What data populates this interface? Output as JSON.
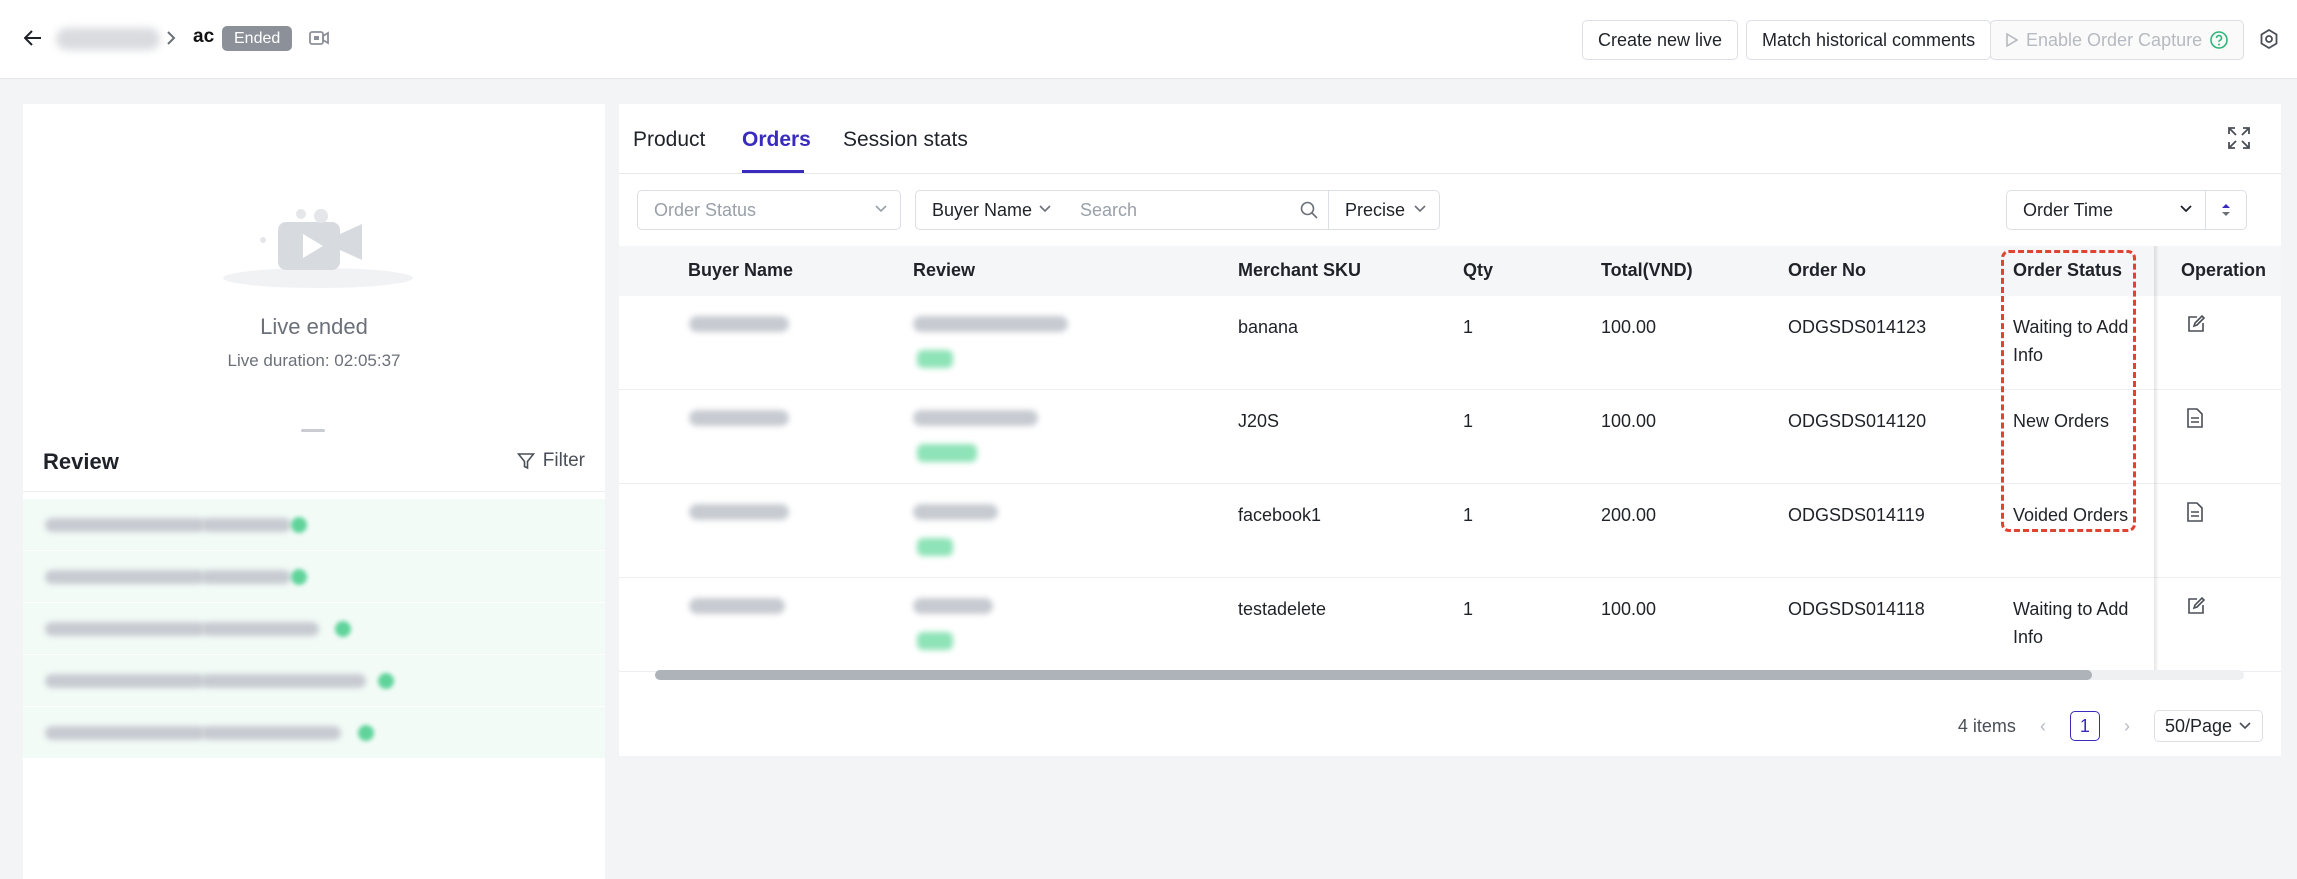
{
  "header": {
    "title": "ac",
    "status_badge": "Ended",
    "buttons": {
      "create_new_live": "Create new live",
      "match_historical_comments": "Match historical comments",
      "enable_order_capture": "Enable Order Capture"
    }
  },
  "live": {
    "status_text": "Live ended",
    "duration_text": "Live duration: 02:05:37"
  },
  "review": {
    "title": "Review",
    "filter_label": "Filter"
  },
  "tabs": [
    {
      "label": "Product"
    },
    {
      "label": "Orders"
    },
    {
      "label": "Session stats"
    }
  ],
  "active_tab": "Orders",
  "filters": {
    "order_status_placeholder": "Order Status",
    "search_field": "Buyer Name",
    "search_placeholder": "Search",
    "match_mode": "Precise",
    "sort_field": "Order Time"
  },
  "table": {
    "columns": [
      "Buyer Name",
      "Review",
      "Merchant SKU",
      "Qty",
      "Total(VND)",
      "Order No",
      "Order Status",
      "Operation"
    ],
    "rows": [
      {
        "merchant_sku": "banana",
        "qty": "1",
        "total": "100.00",
        "order_no": "ODGSDS014123",
        "order_status": "Waiting to Add Info",
        "operation_icon": "edit-icon"
      },
      {
        "merchant_sku": "J20S",
        "qty": "1",
        "total": "100.00",
        "order_no": "ODGSDS014120",
        "order_status": "New Orders",
        "operation_icon": "document-icon"
      },
      {
        "merchant_sku": "facebook1",
        "qty": "1",
        "total": "200.00",
        "order_no": "ODGSDS014119",
        "order_status": "Voided Orders",
        "operation_icon": "document-icon"
      },
      {
        "merchant_sku": "testadelete",
        "qty": "1",
        "total": "100.00",
        "order_no": "ODGSDS014118",
        "order_status": "Waiting to Add Info",
        "operation_icon": "edit-icon"
      }
    ]
  },
  "pagination": {
    "total_text": "4 items",
    "current_page": "1",
    "page_size": "50/Page"
  },
  "colors": {
    "accent": "#3a2bbf",
    "highlight": "#e0432f",
    "badge": "#8c9099"
  }
}
